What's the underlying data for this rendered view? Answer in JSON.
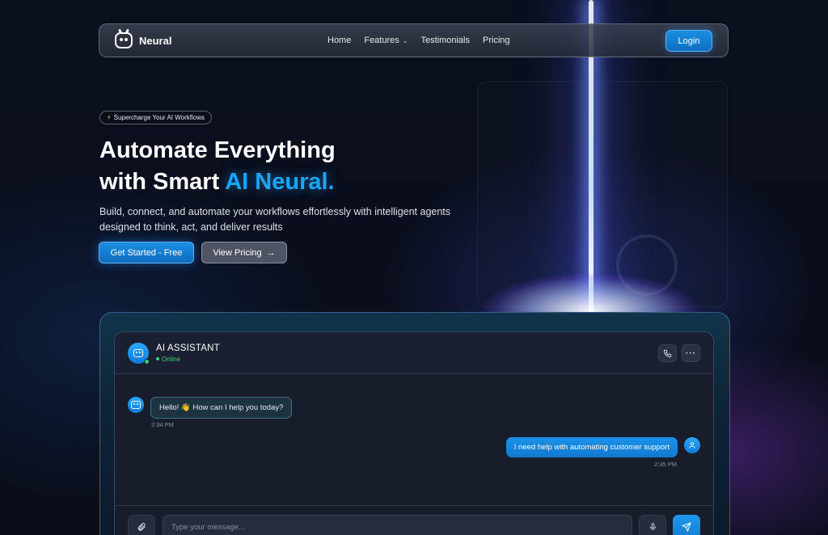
{
  "brand": {
    "name": "Neural"
  },
  "nav": {
    "links": [
      "Home",
      "Features",
      "Testimonials",
      "Pricing"
    ],
    "login_label": "Login"
  },
  "hero": {
    "badge": "Supercharge Your AI Workflows",
    "title_line1": "Automate Everything",
    "title_line2_prefix": "with Smart",
    "title_line2_accent": "AI Neural.",
    "subtitle": "Build, connect, and automate your workflows effortlessly with intelligent agents designed to think, act, and deliver results",
    "cta_primary": "Get Started - Free",
    "cta_secondary": "View Pricing"
  },
  "chat": {
    "assistant_name": "AI ASSISTANT",
    "status": "Online",
    "messages": [
      {
        "from": "bot",
        "text": "Hello! 👋 How can I help you today?",
        "time": "2:34 PM"
      },
      {
        "from": "user",
        "text": "I need help with automating customer support",
        "time": "2:35 PM"
      }
    ],
    "input_placeholder": "Type your message..."
  },
  "colors": {
    "accent": "#1aa5ff",
    "primary_button": "#1b8fe2",
    "online": "#3fd27c",
    "background": "#070b16"
  },
  "icons": [
    "robot-logo-icon",
    "chevron-down-icon",
    "arrow-right-icon",
    "phone-icon",
    "more-icon",
    "user-icon",
    "paperclip-icon",
    "microphone-icon",
    "send-icon",
    "lightning-icon"
  ]
}
